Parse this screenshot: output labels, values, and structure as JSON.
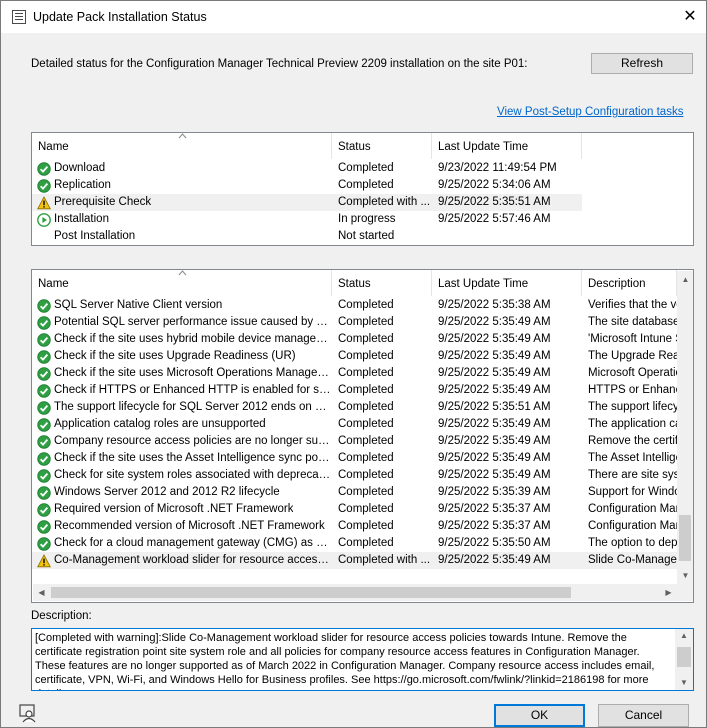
{
  "window": {
    "title": "Update Pack Installation Status",
    "close": "✕"
  },
  "intro": "Detailed status for the Configuration Manager Technical Preview 2209 installation on the site P01:",
  "refresh_label": "Refresh",
  "link_label": "View Post-Setup Configuration tasks",
  "phases": {
    "columns": [
      "Name",
      "Status",
      "Last Update Time"
    ],
    "rows": [
      {
        "icon": "ok",
        "name": "Download",
        "status": "Completed",
        "time": "9/23/2022 11:49:54 PM"
      },
      {
        "icon": "ok",
        "name": "Replication",
        "status": "Completed",
        "time": "9/25/2022 5:34:06 AM"
      },
      {
        "icon": "warn",
        "name": "Prerequisite Check",
        "status": "Completed with ...",
        "time": "9/25/2022 5:35:51 AM",
        "selected": true
      },
      {
        "icon": "play",
        "name": "Installation",
        "status": "In progress",
        "time": "9/25/2022 5:57:46 AM"
      },
      {
        "icon": "none",
        "name": "Post Installation",
        "status": "Not started",
        "time": ""
      }
    ]
  },
  "checks": {
    "columns": [
      "Name",
      "Status",
      "Last Update Time",
      "Description"
    ],
    "rows": [
      {
        "icon": "ok",
        "name": "SQL Server Native Client version",
        "status": "Completed",
        "time": "9/25/2022 5:35:38 AM",
        "desc": "Verifies that the ve"
      },
      {
        "icon": "ok",
        "name": "Potential SQL server performance issue caused by chan...",
        "status": "Completed",
        "time": "9/25/2022 5:35:49 AM",
        "desc": "The site database"
      },
      {
        "icon": "ok",
        "name": "Check if the site uses hybrid mobile device management ...",
        "status": "Completed",
        "time": "9/25/2022 5:35:49 AM",
        "desc": "'Microsoft Intune S"
      },
      {
        "icon": "ok",
        "name": "Check if the site uses Upgrade Readiness (UR)",
        "status": "Completed",
        "time": "9/25/2022 5:35:49 AM",
        "desc": "The Upgrade Read"
      },
      {
        "icon": "ok",
        "name": "Check if the site uses Microsoft Operations Management...",
        "status": "Completed",
        "time": "9/25/2022 5:35:49 AM",
        "desc": "Microsoft Operatio"
      },
      {
        "icon": "ok",
        "name": "Check if HTTPS or Enhanced HTTP is enabled for site s...",
        "status": "Completed",
        "time": "9/25/2022 5:35:49 AM",
        "desc": "HTTPS or Enhanc"
      },
      {
        "icon": "ok",
        "name": "The support lifecycle for SQL Server 2012 ends on July ...",
        "status": "Completed",
        "time": "9/25/2022 5:35:51 AM",
        "desc": "The support lifecyc"
      },
      {
        "icon": "ok",
        "name": "Application catalog roles are unsupported",
        "status": "Completed",
        "time": "9/25/2022 5:35:49 AM",
        "desc": "The application ca"
      },
      {
        "icon": "ok",
        "name": "Company resource access policies are no longer support...",
        "status": "Completed",
        "time": "9/25/2022 5:35:49 AM",
        "desc": "Remove the certifi"
      },
      {
        "icon": "ok",
        "name": "Check if the site uses the Asset Intelligence sync point role",
        "status": "Completed",
        "time": "9/25/2022 5:35:49 AM",
        "desc": "The Asset Intellige"
      },
      {
        "icon": "ok",
        "name": "Check for site system roles associated with deprecated o...",
        "status": "Completed",
        "time": "9/25/2022 5:35:49 AM",
        "desc": "There are site syst"
      },
      {
        "icon": "ok",
        "name": "Windows Server 2012 and 2012 R2 lifecycle",
        "status": "Completed",
        "time": "9/25/2022 5:35:39 AM",
        "desc": "Support for Windo"
      },
      {
        "icon": "ok",
        "name": "Required version of Microsoft .NET Framework",
        "status": "Completed",
        "time": "9/25/2022 5:35:37 AM",
        "desc": "Configuration Man"
      },
      {
        "icon": "ok",
        "name": "Recommended version of Microsoft .NET Framework",
        "status": "Completed",
        "time": "9/25/2022 5:35:37 AM",
        "desc": "Configuration Man"
      },
      {
        "icon": "ok",
        "name": "Check for a cloud management gateway (CMG) as a clo...",
        "status": "Completed",
        "time": "9/25/2022 5:35:50 AM",
        "desc": "The option to depl"
      },
      {
        "icon": "warn",
        "name": "Co-Management workload slider for resource access poli...",
        "status": "Completed with ...",
        "time": "9/25/2022 5:35:49 AM",
        "desc": "Slide Co-Managem",
        "selected": true
      }
    ]
  },
  "description_label": "Description:",
  "description_text": "[Completed with warning]:Slide Co-Management workload slider for resource access policies towards Intune. Remove the certificate registration point site system role and all policies for company resource access features in Configuration Manager. These features are no longer supported as of March 2022 in Configuration Manager. Company resource access includes email, certificate, VPN, Wi-Fi, and Windows Hello for Business profiles. See https://go.microsoft.com/fwlink/?linkid=2186198 for more details.",
  "ok_label": "OK",
  "cancel_label": "Cancel",
  "colors": {
    "ok_green": "#2ea043",
    "warn_yellow": "#f2c40f",
    "link_blue": "#0066cc",
    "focus_blue": "#0078d7"
  }
}
